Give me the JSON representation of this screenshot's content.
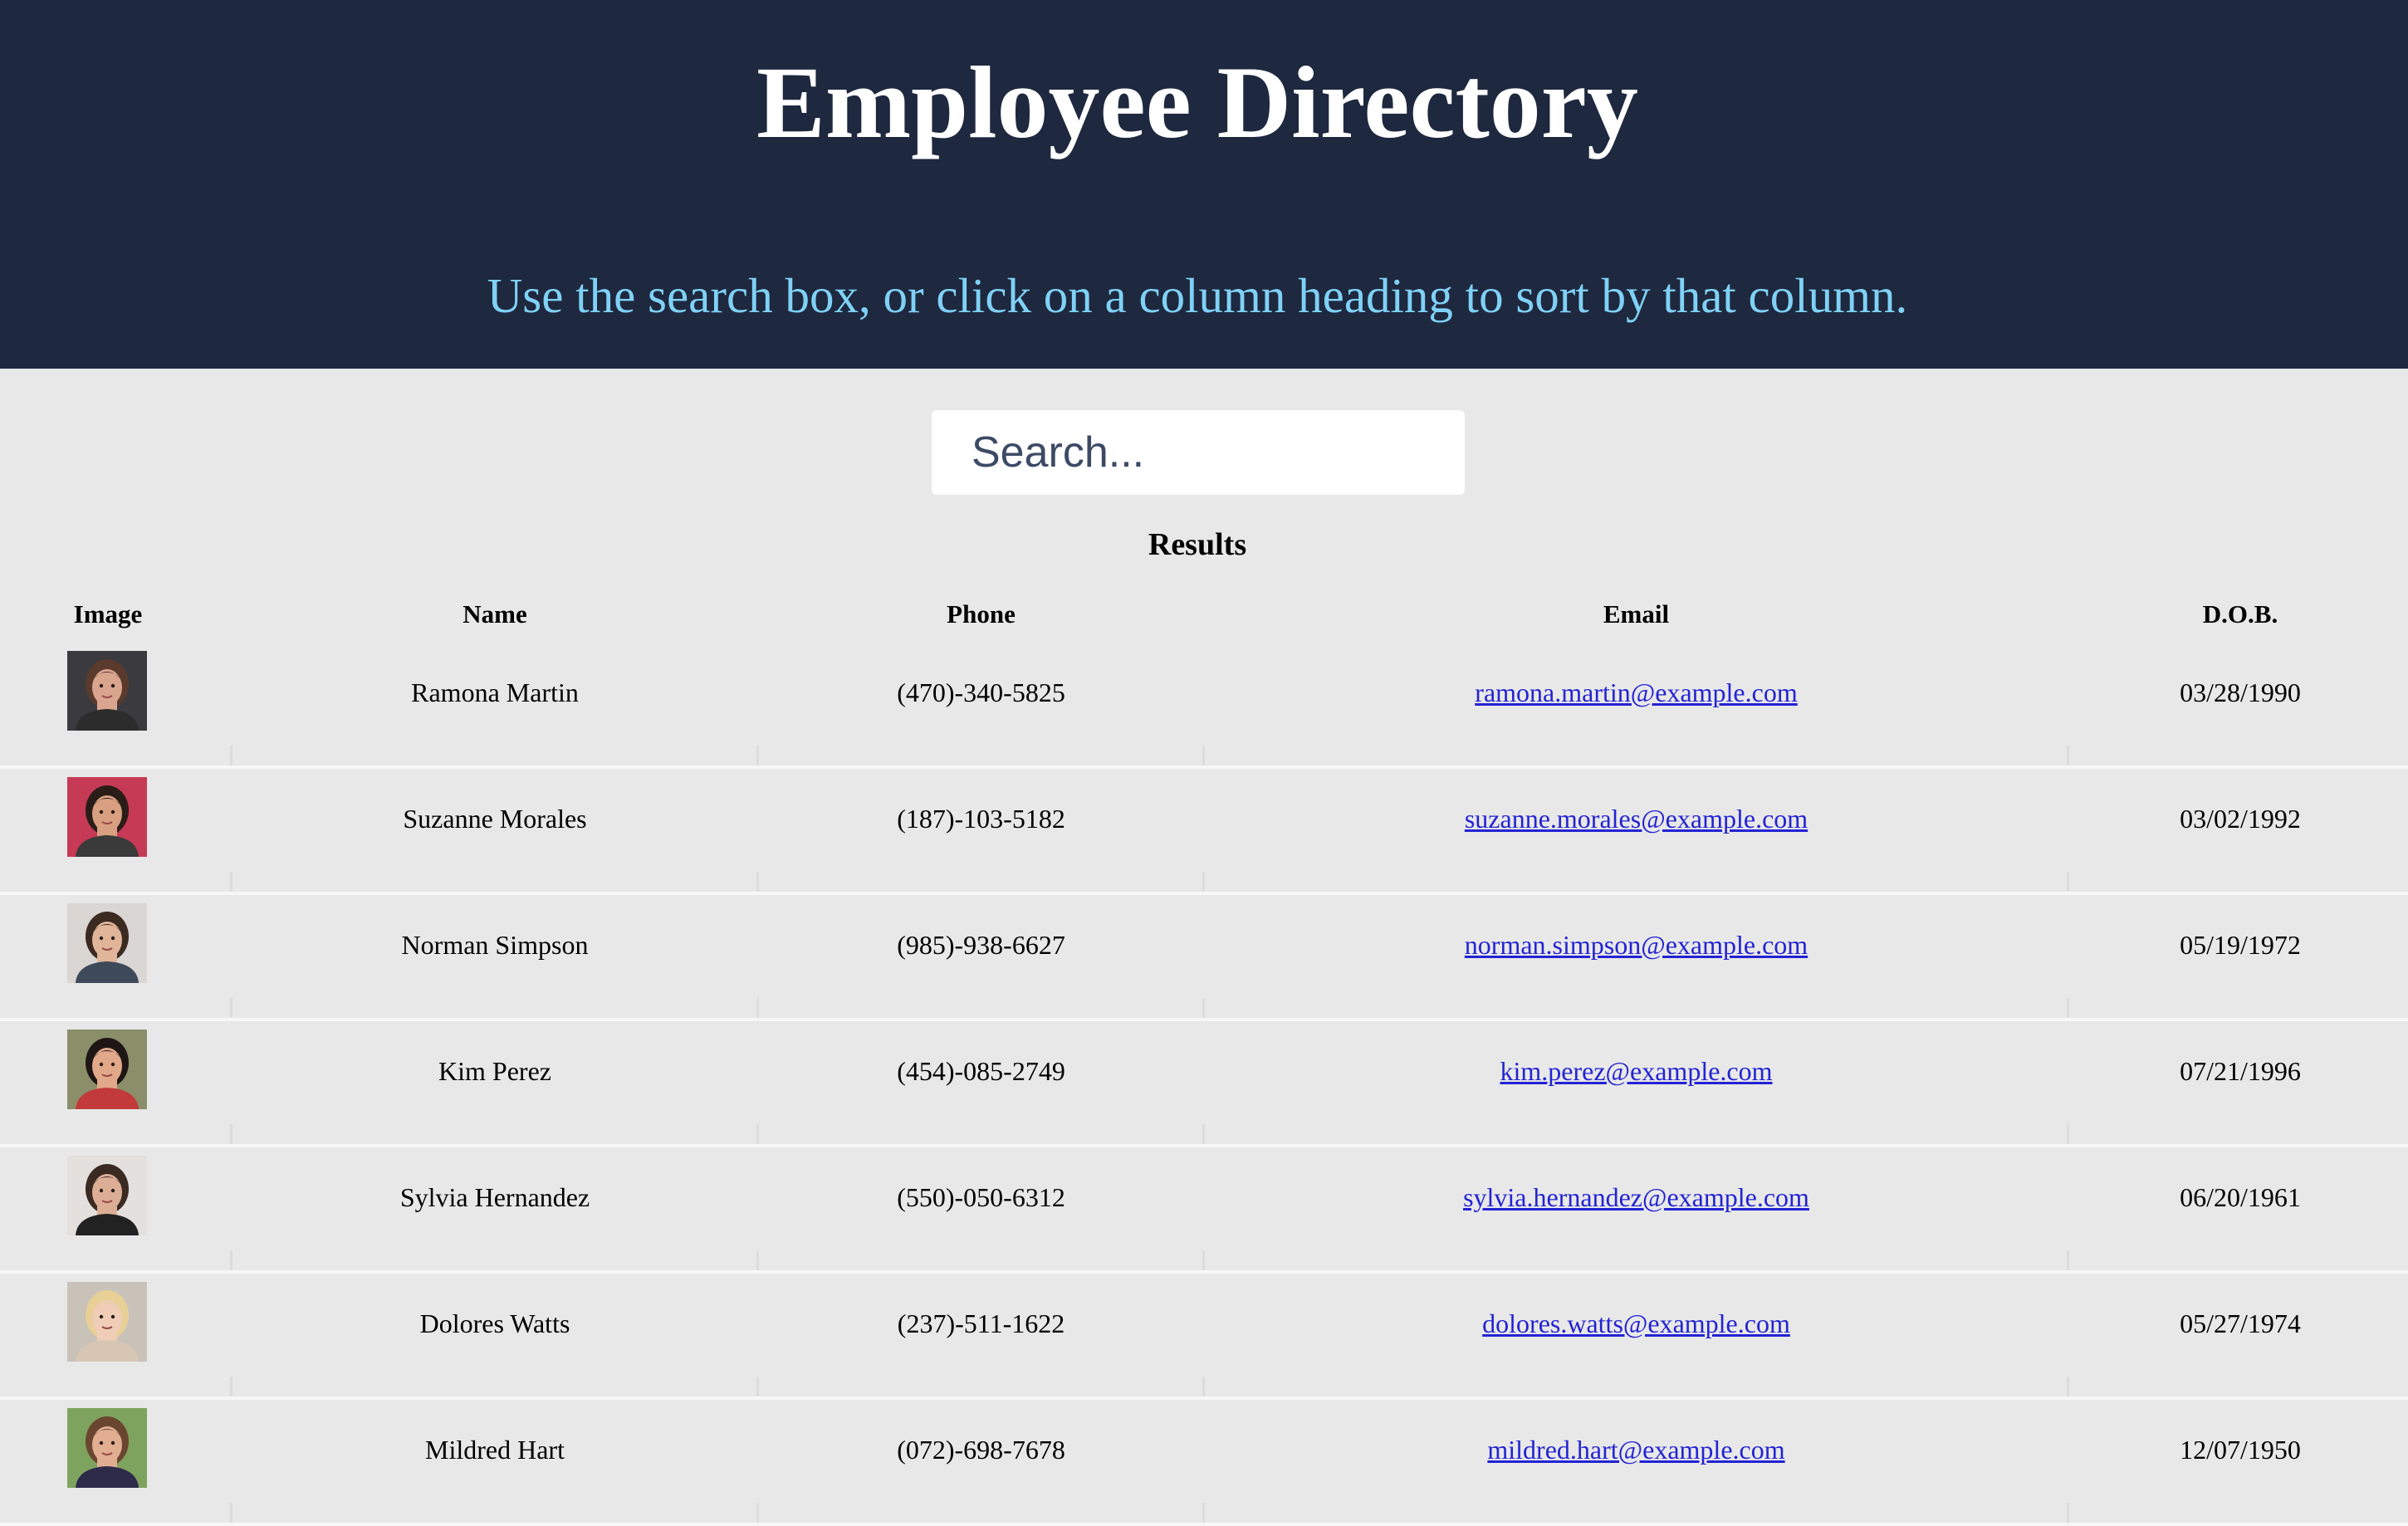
{
  "header": {
    "title": "Employee Directory",
    "subtitle": "Use the search box, or click on a column heading to sort by that column."
  },
  "search": {
    "placeholder": "Search...",
    "value": ""
  },
  "results_label": "Results",
  "columns": [
    "Image",
    "Name",
    "Phone",
    "Email",
    "D.O.B."
  ],
  "employees": [
    {
      "name": "Ramona Martin",
      "phone": "(470)-340-5825",
      "email": "ramona.martin@example.com",
      "dob": "03/28/1990",
      "image": "woman-portrait-icon"
    },
    {
      "name": "Suzanne Morales",
      "phone": "(187)-103-5182",
      "email": "suzanne.morales@example.com",
      "dob": "03/02/1992",
      "image": "woman-portrait-icon"
    },
    {
      "name": "Norman Simpson",
      "phone": "(985)-938-6627",
      "email": "norman.simpson@example.com",
      "dob": "05/19/1972",
      "image": "man-portrait-icon"
    },
    {
      "name": "Kim Perez",
      "phone": "(454)-085-2749",
      "email": "kim.perez@example.com",
      "dob": "07/21/1996",
      "image": "woman-portrait-icon"
    },
    {
      "name": "Sylvia Hernandez",
      "phone": "(550)-050-6312",
      "email": "sylvia.hernandez@example.com",
      "dob": "06/20/1961",
      "image": "woman-portrait-icon"
    },
    {
      "name": "Dolores Watts",
      "phone": "(237)-511-1622",
      "email": "dolores.watts@example.com",
      "dob": "05/27/1974",
      "image": "woman-portrait-icon"
    },
    {
      "name": "Mildred Hart",
      "phone": "(072)-698-7678",
      "email": "mildred.hart@example.com",
      "dob": "12/07/1950",
      "image": "woman-portrait-icon"
    }
  ],
  "colors": {
    "header_bg": "#1e283e",
    "title": "#ffffff",
    "subtitle": "#7fd1f6",
    "page_bg": "#e8e8e8",
    "link": "#2323d4"
  }
}
